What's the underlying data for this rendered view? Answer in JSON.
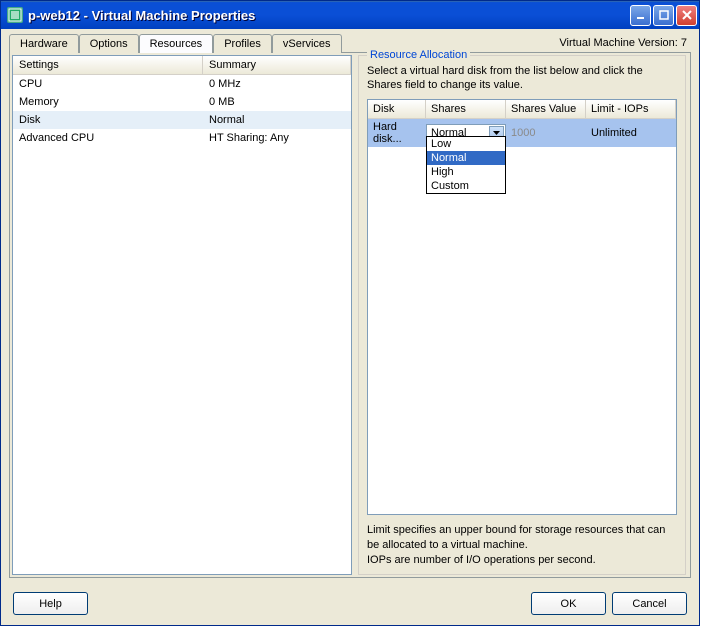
{
  "titlebar": {
    "title": "p-web12 - Virtual Machine Properties"
  },
  "tabs": [
    {
      "label": "Hardware"
    },
    {
      "label": "Options"
    },
    {
      "label": "Resources"
    },
    {
      "label": "Profiles"
    },
    {
      "label": "vServices"
    }
  ],
  "version_text": "Virtual Machine Version: 7",
  "left_grid": {
    "headers": {
      "settings": "Settings",
      "summary": "Summary"
    },
    "rows": [
      {
        "setting": "CPU",
        "summary": "0 MHz"
      },
      {
        "setting": "Memory",
        "summary": "0 MB"
      },
      {
        "setting": "Disk",
        "summary": "Normal",
        "selected": true
      },
      {
        "setting": "Advanced CPU",
        "summary": "HT Sharing: Any"
      }
    ]
  },
  "right": {
    "group_title": "Resource Allocation",
    "help_text": "Select a virtual hard disk from the list below and click the Shares field to change its value.",
    "disk_table": {
      "headers": {
        "disk": "Disk",
        "shares": "Shares",
        "shares_value": "Shares Value",
        "limit": "Limit - IOPs"
      },
      "row": {
        "disk": "Hard disk...",
        "shares": "Normal",
        "shares_value": "1000",
        "limit": "Unlimited"
      },
      "dropdown": [
        "Low",
        "Normal",
        "High",
        "Custom"
      ]
    },
    "bottom_text_1": "Limit specifies an upper bound for storage resources that can be allocated to a virtual machine.",
    "bottom_text_2": "IOPs are number of I/O operations per second."
  },
  "buttons": {
    "help": "Help",
    "ok": "OK",
    "cancel": "Cancel"
  }
}
